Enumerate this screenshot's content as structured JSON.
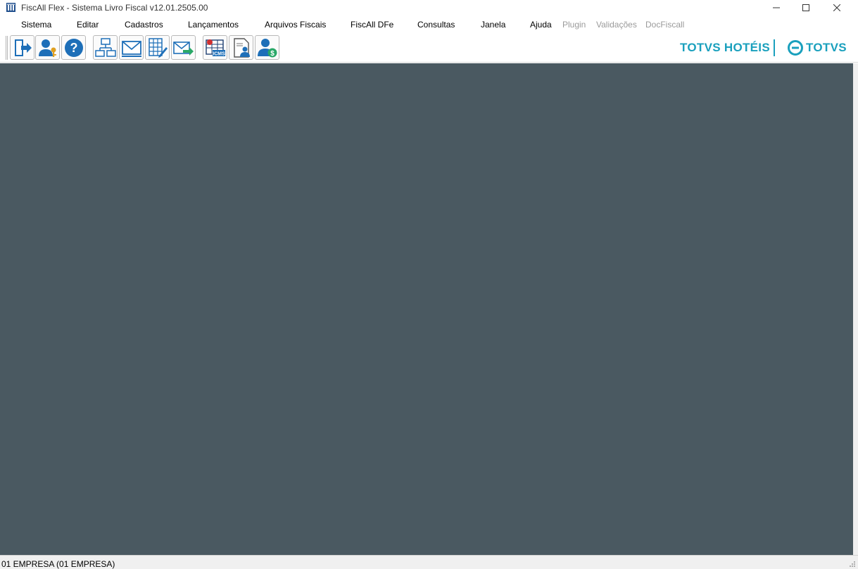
{
  "window": {
    "title": "FiscAll Flex - Sistema Livro Fiscal v12.01.2505.00",
    "controls": {
      "minimize": "minimize-icon",
      "maximize": "maximize-icon",
      "close": "close-icon"
    }
  },
  "menu": {
    "sistema": "Sistema",
    "editar": "Editar",
    "cadastros": "Cadastros",
    "lancamentos": "Lançamentos",
    "arquivos_fiscais": "Arquivos Fiscais",
    "fiscall_dfe": "FiscAll DFe",
    "consultas": "Consultas",
    "janela": "Janela",
    "ajuda": "Ajuda",
    "plugin": "Plugin",
    "validacoes": "Validações",
    "docfiscall": "DocFiscall"
  },
  "toolbar": {
    "buttons": [
      {
        "icon": "exit-door-icon"
      },
      {
        "icon": "user-key-icon"
      },
      {
        "icon": "help-icon"
      },
      {
        "icon": "network-structure-icon"
      },
      {
        "icon": "mail-icon"
      },
      {
        "icon": "spreadsheet-edit-icon"
      },
      {
        "icon": "send-mail-icon"
      },
      {
        "icon": "icms-table-icon"
      },
      {
        "icon": "user-document-icon"
      },
      {
        "icon": "user-money-icon"
      }
    ],
    "icms_badge": "ICMS"
  },
  "branding": {
    "hotels": "TOTVS HOTÉIS",
    "company": "TOTVS",
    "accent_color": "#1aa0bd"
  },
  "colors": {
    "workspace_bg": "#4a5961"
  },
  "status": {
    "company": "01 EMPRESA (01 EMPRESA)"
  }
}
